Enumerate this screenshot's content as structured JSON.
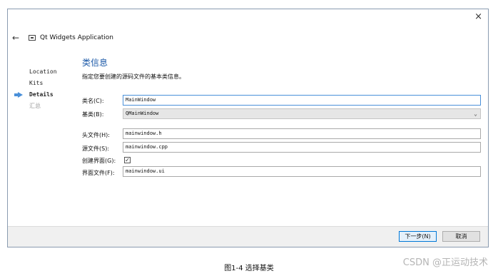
{
  "window": {
    "close_glyph": "×",
    "back_glyph": "←",
    "app_title": "Qt Widgets Application"
  },
  "steps": [
    {
      "label": "Location",
      "state": "done"
    },
    {
      "label": "Kits",
      "state": "done"
    },
    {
      "label": "Details",
      "state": "current"
    },
    {
      "label": "汇总",
      "state": "pending"
    }
  ],
  "page": {
    "title": "类信息",
    "description": "指定您要创建的源码文件的基本类信息。"
  },
  "form": {
    "class_name": {
      "label": "类名(C):",
      "value": "MainWindow"
    },
    "base_class": {
      "label": "基类(B):",
      "value": "QMainWindow"
    },
    "header_file": {
      "label": "头文件(H):",
      "value": "mainwindow.h"
    },
    "source_file": {
      "label": "源文件(S):",
      "value": "mainwindow.cpp"
    },
    "generate_form": {
      "label": "创建界面(G):",
      "checked": true,
      "glyph": "✓"
    },
    "form_file": {
      "label": "界面文件(F):",
      "value": "mainwindow.ui"
    }
  },
  "buttons": {
    "next": "下一步(N)",
    "cancel": "取消"
  },
  "caption": "图1-4   选择基类",
  "watermark": "CSDN @正运动技术",
  "colors": {
    "accent": "#1d5aa8",
    "step_arrow": "#4a90d9",
    "primary_button_border": "#0078d7"
  }
}
